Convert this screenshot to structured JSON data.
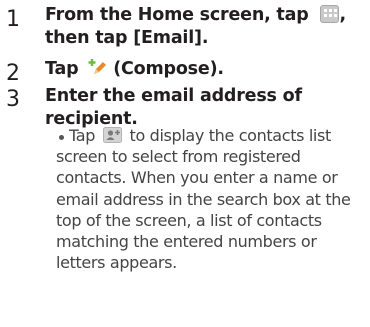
{
  "steps": [
    {
      "number": "1",
      "line1_pre": "From the Home screen, tap",
      "line1_post": ",",
      "line2": "then tap [Email].",
      "icon": "app-grid-icon"
    },
    {
      "number": "2",
      "text_pre": "Tap",
      "text_post": "(Compose).",
      "icon": "compose-icon"
    },
    {
      "number": "3",
      "line1": "Enter the email address of",
      "line2": "recipient."
    }
  ],
  "note": {
    "pre": "Tap",
    "line1_post": "to display the contacts list",
    "icon": "contacts-icon",
    "lines": [
      "screen to select from registered",
      "contacts. When you enter a name or",
      "email address in the search box at the",
      "top of the screen, a list of contacts",
      "matching the entered numbers or",
      "letters appears."
    ]
  },
  "colors": {
    "text": "#231f20",
    "body_text": "#444444",
    "icon_gray": "#c9c9c9",
    "compose_green": "#6cbf3a",
    "compose_orange": "#e88a2a"
  }
}
